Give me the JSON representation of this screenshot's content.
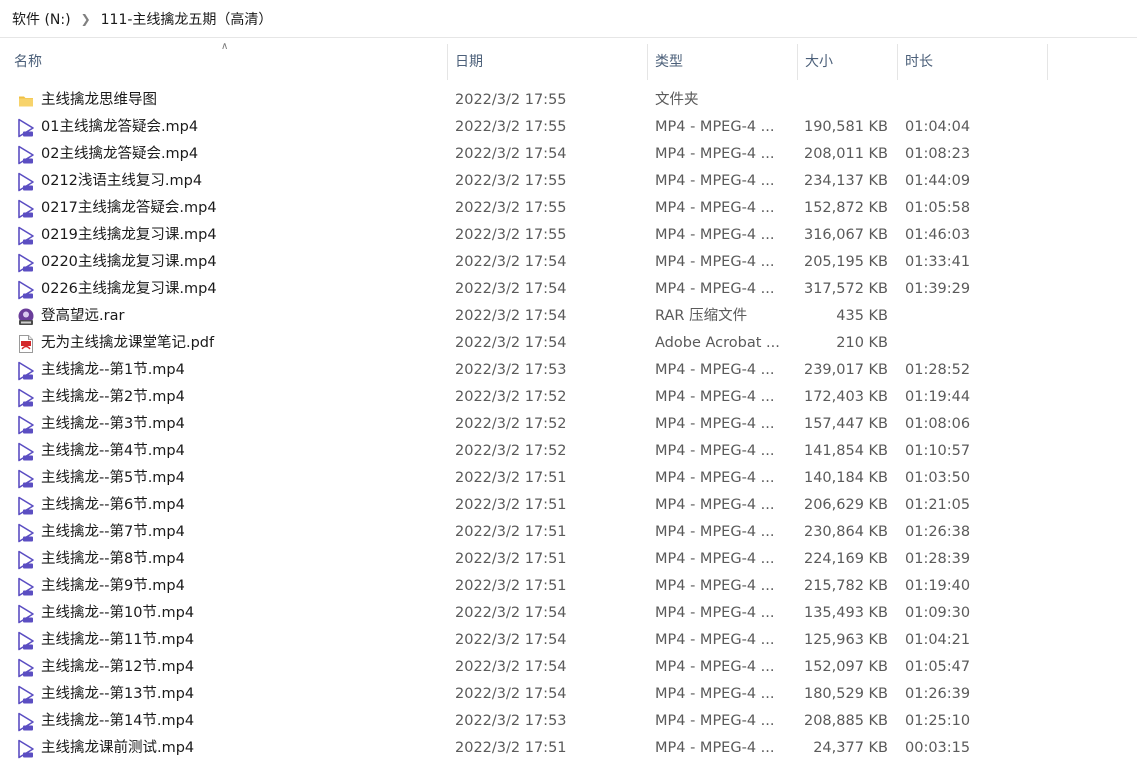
{
  "breadcrumb": {
    "drive": "软件 (N:)",
    "folder": "111-主线擒龙五期（高清）"
  },
  "columns": {
    "name": "名称",
    "date": "日期",
    "type": "类型",
    "size": "大小",
    "duration": "时长"
  },
  "files": [
    {
      "icon": "folder-icon",
      "name": "主线擒龙思维导图",
      "date": "2022/3/2 17:55",
      "type": "文件夹",
      "size": "",
      "duration": ""
    },
    {
      "icon": "video-file-icon",
      "name": "01主线擒龙答疑会.mp4",
      "date": "2022/3/2 17:55",
      "type": "MP4 - MPEG-4 ...",
      "size": "190,581 KB",
      "duration": "01:04:04"
    },
    {
      "icon": "video-file-icon",
      "name": "02主线擒龙答疑会.mp4",
      "date": "2022/3/2 17:54",
      "type": "MP4 - MPEG-4 ...",
      "size": "208,011 KB",
      "duration": "01:08:23"
    },
    {
      "icon": "video-file-icon",
      "name": "0212浅语主线复习.mp4",
      "date": "2022/3/2 17:55",
      "type": "MP4 - MPEG-4 ...",
      "size": "234,137 KB",
      "duration": "01:44:09"
    },
    {
      "icon": "video-file-icon",
      "name": "0217主线擒龙答疑会.mp4",
      "date": "2022/3/2 17:55",
      "type": "MP4 - MPEG-4 ...",
      "size": "152,872 KB",
      "duration": "01:05:58"
    },
    {
      "icon": "video-file-icon",
      "name": "0219主线擒龙复习课.mp4",
      "date": "2022/3/2 17:55",
      "type": "MP4 - MPEG-4 ...",
      "size": "316,067 KB",
      "duration": "01:46:03"
    },
    {
      "icon": "video-file-icon",
      "name": "0220主线擒龙复习课.mp4",
      "date": "2022/3/2 17:54",
      "type": "MP4 - MPEG-4 ...",
      "size": "205,195 KB",
      "duration": "01:33:41"
    },
    {
      "icon": "video-file-icon",
      "name": "0226主线擒龙复习课.mp4",
      "date": "2022/3/2 17:54",
      "type": "MP4 - MPEG-4 ...",
      "size": "317,572 KB",
      "duration": "01:39:29"
    },
    {
      "icon": "rar-archive-icon",
      "name": "登高望远.rar",
      "date": "2022/3/2 17:54",
      "type": "RAR 压缩文件",
      "size": "435 KB",
      "duration": ""
    },
    {
      "icon": "pdf-file-icon",
      "name": "无为主线擒龙课堂笔记.pdf",
      "date": "2022/3/2 17:54",
      "type": "Adobe Acrobat ...",
      "size": "210 KB",
      "duration": ""
    },
    {
      "icon": "video-file-icon",
      "name": "主线擒龙--第1节.mp4",
      "date": "2022/3/2 17:53",
      "type": "MP4 - MPEG-4 ...",
      "size": "239,017 KB",
      "duration": "01:28:52"
    },
    {
      "icon": "video-file-icon",
      "name": "主线擒龙--第2节.mp4",
      "date": "2022/3/2 17:52",
      "type": "MP4 - MPEG-4 ...",
      "size": "172,403 KB",
      "duration": "01:19:44"
    },
    {
      "icon": "video-file-icon",
      "name": "主线擒龙--第3节.mp4",
      "date": "2022/3/2 17:52",
      "type": "MP4 - MPEG-4 ...",
      "size": "157,447 KB",
      "duration": "01:08:06"
    },
    {
      "icon": "video-file-icon",
      "name": "主线擒龙--第4节.mp4",
      "date": "2022/3/2 17:52",
      "type": "MP4 - MPEG-4 ...",
      "size": "141,854 KB",
      "duration": "01:10:57"
    },
    {
      "icon": "video-file-icon",
      "name": "主线擒龙--第5节.mp4",
      "date": "2022/3/2 17:51",
      "type": "MP4 - MPEG-4 ...",
      "size": "140,184 KB",
      "duration": "01:03:50"
    },
    {
      "icon": "video-file-icon",
      "name": "主线擒龙--第6节.mp4",
      "date": "2022/3/2 17:51",
      "type": "MP4 - MPEG-4 ...",
      "size": "206,629 KB",
      "duration": "01:21:05"
    },
    {
      "icon": "video-file-icon",
      "name": "主线擒龙--第7节.mp4",
      "date": "2022/3/2 17:51",
      "type": "MP4 - MPEG-4 ...",
      "size": "230,864 KB",
      "duration": "01:26:38"
    },
    {
      "icon": "video-file-icon",
      "name": "主线擒龙--第8节.mp4",
      "date": "2022/3/2 17:51",
      "type": "MP4 - MPEG-4 ...",
      "size": "224,169 KB",
      "duration": "01:28:39"
    },
    {
      "icon": "video-file-icon",
      "name": "主线擒龙--第9节.mp4",
      "date": "2022/3/2 17:51",
      "type": "MP4 - MPEG-4 ...",
      "size": "215,782 KB",
      "duration": "01:19:40"
    },
    {
      "icon": "video-file-icon",
      "name": "主线擒龙--第10节.mp4",
      "date": "2022/3/2 17:54",
      "type": "MP4 - MPEG-4 ...",
      "size": "135,493 KB",
      "duration": "01:09:30"
    },
    {
      "icon": "video-file-icon",
      "name": "主线擒龙--第11节.mp4",
      "date": "2022/3/2 17:54",
      "type": "MP4 - MPEG-4 ...",
      "size": "125,963 KB",
      "duration": "01:04:21"
    },
    {
      "icon": "video-file-icon",
      "name": "主线擒龙--第12节.mp4",
      "date": "2022/3/2 17:54",
      "type": "MP4 - MPEG-4 ...",
      "size": "152,097 KB",
      "duration": "01:05:47"
    },
    {
      "icon": "video-file-icon",
      "name": "主线擒龙--第13节.mp4",
      "date": "2022/3/2 17:54",
      "type": "MP4 - MPEG-4 ...",
      "size": "180,529 KB",
      "duration": "01:26:39"
    },
    {
      "icon": "video-file-icon",
      "name": "主线擒龙--第14节.mp4",
      "date": "2022/3/2 17:53",
      "type": "MP4 - MPEG-4 ...",
      "size": "208,885 KB",
      "duration": "01:25:10"
    },
    {
      "icon": "video-file-icon",
      "name": "主线擒龙课前测试.mp4",
      "date": "2022/3/2 17:51",
      "type": "MP4 - MPEG-4 ...",
      "size": "24,377 KB",
      "duration": "00:03:15"
    }
  ],
  "colors": {
    "header_text": "#4c607a",
    "folder": "#f0c044",
    "video_icon": "#5b4ec2",
    "pdf": "#d4272a",
    "rar": "#6a3d9a"
  }
}
